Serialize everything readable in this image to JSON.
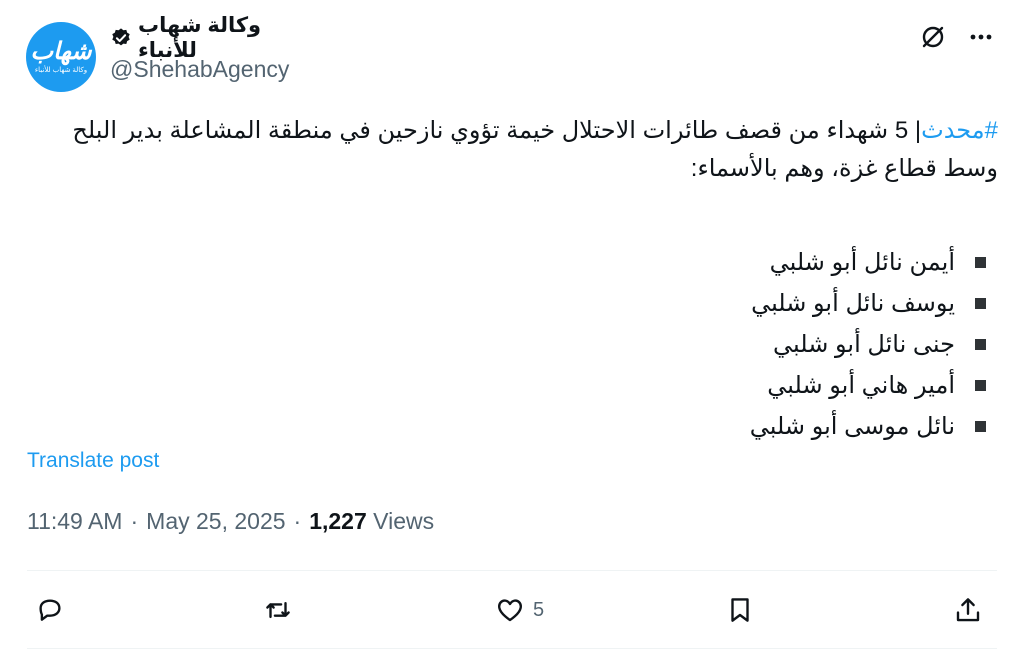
{
  "account": {
    "display_name": "وكالة شهاب للأنباء",
    "handle": "@ShehabAgency",
    "avatar_logo": "شهاب",
    "avatar_subtitle": "وكالة شهاب للأنباء"
  },
  "tweet": {
    "hashtag": "#محدث",
    "body": "| 5 شهداء من قصف طائرات الاحتلال خيمة تؤوي نازحين في منطقة المشاعلة بدير البلح وسط قطاع غزة، وهم بالأسماء:",
    "names": [
      "أيمن نائل أبو شلبي",
      "يوسف نائل أبو شلبي",
      "جنى نائل أبو شلبي",
      "أمير هاني أبو شلبي",
      "نائل موسى أبو شلبي"
    ],
    "translate_label": "Translate post"
  },
  "meta": {
    "time": "11:49 AM",
    "date": "May 25, 2025",
    "views_count": "1,227",
    "views_label": "Views",
    "separator": "·"
  },
  "actions": {
    "reply_count": "",
    "retweet_count": "",
    "like_count": "5",
    "bookmark_count": ""
  },
  "icons": {
    "verified": "verified-badge-icon",
    "grok": "slash-circle-icon",
    "more": "more-icon",
    "reply": "reply-icon",
    "retweet": "retweet-icon",
    "like": "heart-icon",
    "bookmark": "bookmark-icon",
    "share": "share-icon"
  },
  "colors": {
    "accent": "#1d9bf0",
    "secondary_text": "#536471",
    "primary_text": "#0f1419"
  }
}
